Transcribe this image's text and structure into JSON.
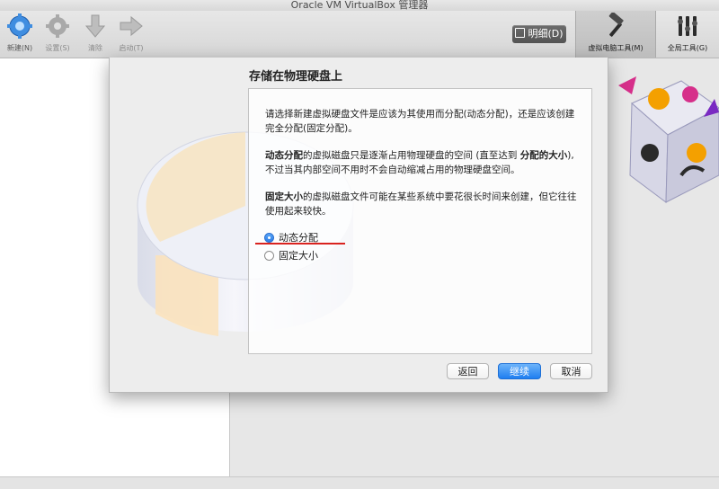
{
  "window": {
    "title": "Oracle VM VirtualBox 管理器"
  },
  "toolbar": {
    "new_label": "新建(N)",
    "settings_label": "设置(S)",
    "discard_label": "清除",
    "start_label": "启动(T)",
    "detail_label": "明细(D)",
    "machine_tools_label": "虚拟电脑工具(M)",
    "global_tools_label": "全局工具(G)"
  },
  "dialog": {
    "title": "存储在物理硬盘上",
    "intro": "请选择新建虚拟硬盘文件是应该为其使用而分配(动态分配)，还是应该创建完全分配(固定分配)。",
    "dynamic_bold": "动态分配",
    "dynamic_text": "的虚拟磁盘只是逐渐占用物理硬盘的空间 (直至达到 ",
    "dynamic_bold2": "分配的大小",
    "dynamic_text2": "), 不过当其内部空间不用时不会自动缩减占用的物理硬盘空间。",
    "fixed_bold": "固定大小",
    "fixed_text": "的虚拟磁盘文件可能在某些系统中要花很长时间来创建，但它往往使用起来较快。",
    "options": [
      {
        "label": "动态分配",
        "selected": true
      },
      {
        "label": "固定大小",
        "selected": false
      }
    ],
    "buttons": {
      "back": "返回",
      "continue": "继续",
      "cancel": "取消"
    }
  },
  "colors": {
    "accent": "#2b7de8",
    "underline": "#d9231f"
  }
}
